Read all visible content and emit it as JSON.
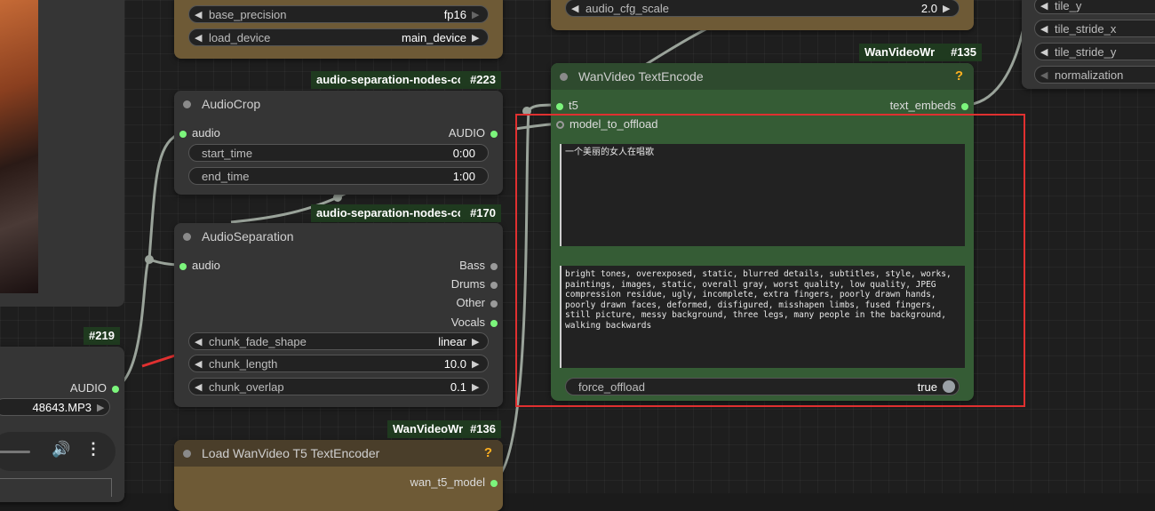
{
  "nodes": {
    "top_left_loader": {
      "widgets": [
        {
          "label": "base_precision",
          "value": "fp16"
        },
        {
          "label": "load_device",
          "value": "main_device"
        }
      ]
    },
    "top_mid": {
      "widgets": [
        {
          "label": "audio_cfg_scale",
          "value": "2.0"
        }
      ]
    },
    "top_right": {
      "widgets": [
        {
          "label": "tile_y"
        },
        {
          "label": "tile_stride_x"
        },
        {
          "label": "tile_stride_y"
        },
        {
          "label": "normalization"
        }
      ]
    },
    "audio_crop": {
      "badge_name": "audio-separation-nodes-cc",
      "badge_id": "#223",
      "title": "AudioCrop",
      "inputs": [
        "audio"
      ],
      "outputs": [
        "AUDIO"
      ],
      "widgets": [
        {
          "label": "start_time",
          "value": "0:00"
        },
        {
          "label": "end_time",
          "value": "1:00"
        }
      ]
    },
    "audio_separation": {
      "badge_name": "audio-separation-nodes-cc",
      "badge_id": "#170",
      "title": "AudioSeparation",
      "inputs": [
        "audio"
      ],
      "outputs": [
        "Bass",
        "Drums",
        "Other",
        "Vocals"
      ],
      "widgets": [
        {
          "label": "chunk_fade_shape",
          "value": "linear"
        },
        {
          "label": "chunk_length",
          "value": "10.0"
        },
        {
          "label": "chunk_overlap",
          "value": "0.1"
        }
      ]
    },
    "load_audio": {
      "badge_id": "#219",
      "output": "AUDIO",
      "file": "48643.MP3"
    },
    "t5_loader": {
      "badge_name": "WanVideoWr",
      "badge_id": "#136",
      "title": "Load WanVideo T5 TextEncoder",
      "help": "?",
      "output": "wan_t5_model"
    },
    "text_encode": {
      "badge_name": "WanVideoWr",
      "badge_id": "#135",
      "title": "WanVideo TextEncode",
      "help": "?",
      "inputs": [
        "t5",
        "model_to_offload"
      ],
      "output": "text_embeds",
      "positive_prompt": "一个美丽的女人在唱歌",
      "negative_prompt": "bright tones, overexposed, static, blurred details, subtitles, style, works, paintings, images, static, overall gray, worst quality, low quality, JPEG compression residue, ugly, incomplete, extra fingers, poorly drawn hands, poorly drawn faces, deformed, disfigured, misshapen limbs, fused fingers, still picture, messy background, three legs, many people in the background, walking backwards",
      "toggle": {
        "label": "force_offload",
        "value": "true"
      }
    }
  },
  "colors": {
    "accent_green": "#7cf57c",
    "wan_header": "#2e4a2e",
    "wan_body": "#355c35",
    "loader_body": "#6e5a36",
    "highlight": "#e03030"
  }
}
